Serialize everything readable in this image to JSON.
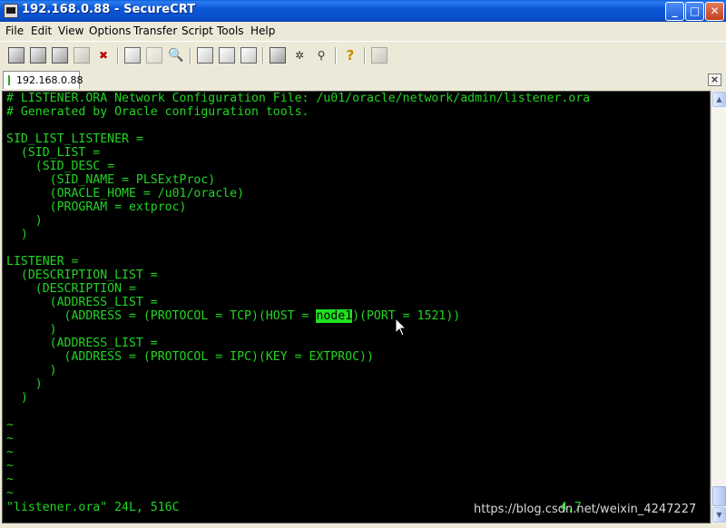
{
  "window": {
    "title": "192.168.0.88 - SecureCRT",
    "buttons": {
      "minimize": "_",
      "maximize": "□",
      "close": "✕"
    }
  },
  "menu": {
    "items": [
      "File",
      "Edit",
      "View",
      "Options",
      "Transfer",
      "Script",
      "Tools",
      "Help"
    ]
  },
  "toolbar": {
    "icons": [
      "connect-icon",
      "quick-connect-icon",
      "connect-in-tab-icon",
      "reconnect-icon",
      "disconnect-icon",
      "copy-icon",
      "paste-icon",
      "find-icon",
      "print-icon",
      "print-selection-icon",
      "print-setup-icon",
      "session-options-icon",
      "global-options-icon",
      "keymap-icon",
      "help-icon",
      "sftp-icon"
    ]
  },
  "tabs": [
    {
      "label": "192.168.0.88",
      "status_color": "#22aa22"
    }
  ],
  "terminal": {
    "text_color": "#23d423",
    "highlight_color": "#1fe01f",
    "lines": [
      "# LISTENER.ORA Network Configuration File: /u01/oracle/network/admin/listener.ora",
      "# Generated by Oracle configuration tools.",
      "",
      "SID_LIST_LISTENER =",
      "  (SID_LIST =",
      "    (SID_DESC =",
      "      (SID_NAME = PLSExtProc)",
      "      (ORACLE_HOME = /u01/oracle)",
      "      (PROGRAM = extproc)",
      "    )",
      "  )",
      "",
      "LISTENER =",
      "  (DESCRIPTION_LIST =",
      "    (DESCRIPTION =",
      "      (ADDRESS_LIST =",
      "        (ADDRESS = (PROTOCOL = TCP)(HOST = ",
      "      )",
      "      (ADDRESS_LIST =",
      "        (ADDRESS = (PROTOCOL = IPC)(KEY = EXTPROC))",
      "      )",
      "    )",
      "  )"
    ],
    "host_line": {
      "before": "        (ADDRESS = (PROTOCOL = TCP)(HOST = ",
      "highlighted": "node1",
      "after": ")(PORT = 1521))"
    },
    "tilde": "~",
    "tilde_count": 6,
    "status_line": "\"listener.ora\" 24L, 516C",
    "cursor_position": "4,7"
  },
  "watermark": "https://blog.csdn.net/weixin_4247227"
}
